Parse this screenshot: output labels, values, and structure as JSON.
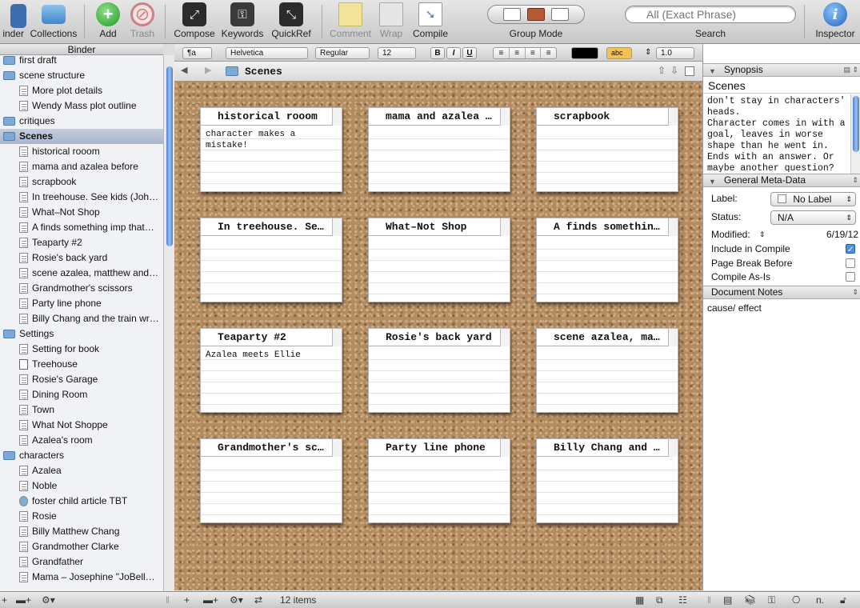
{
  "toolbar": {
    "binder": "Binder",
    "binder_visible": "inder",
    "collections": "Collections",
    "add": "Add",
    "trash": "Trash",
    "compose": "Compose",
    "keywords": "Keywords",
    "quickref": "QuickRef",
    "comment": "Comment",
    "wrap": "Wrap",
    "compile": "Compile",
    "group_mode": "Group Mode",
    "search_placeholder": "All (Exact Phrase)",
    "search_label": "Search",
    "inspector": "Inspector"
  },
  "binder": {
    "header": "Binder",
    "items": [
      {
        "label": "first draft",
        "icon": "folder-icon",
        "indent": 0
      },
      {
        "label": "scene structure",
        "icon": "folder-icon",
        "indent": 0
      },
      {
        "label": "More plot details",
        "icon": "document-icon",
        "indent": 1
      },
      {
        "label": "Wendy Mass plot outline",
        "icon": "document-icon",
        "indent": 1
      },
      {
        "label": "critiques",
        "icon": "folder-icon",
        "indent": 0
      },
      {
        "label": "Scenes",
        "icon": "folder-icon",
        "indent": 0,
        "selected": true
      },
      {
        "label": "historical rooom",
        "icon": "document-icon",
        "indent": 1
      },
      {
        "label": "mama and azalea before",
        "icon": "document-icon",
        "indent": 1
      },
      {
        "label": "scrapbook",
        "icon": "document-icon",
        "indent": 1
      },
      {
        "label": "In treehouse. See kids (Joh…",
        "icon": "document-icon",
        "indent": 1
      },
      {
        "label": "What–Not Shop",
        "icon": "document-icon",
        "indent": 1
      },
      {
        "label": "A finds something imp that…",
        "icon": "document-icon",
        "indent": 1
      },
      {
        "label": "Teaparty #2",
        "icon": "document-icon",
        "indent": 1
      },
      {
        "label": "Rosie's back yard",
        "icon": "document-icon",
        "indent": 1
      },
      {
        "label": "scene azalea, matthew and …",
        "icon": "document-icon",
        "indent": 1
      },
      {
        "label": "Grandmother's scissors",
        "icon": "document-icon",
        "indent": 1
      },
      {
        "label": "Party line phone",
        "icon": "document-icon",
        "indent": 1
      },
      {
        "label": "Billy Chang and the train wr…",
        "icon": "document-icon",
        "indent": 1
      },
      {
        "label": "Settings",
        "icon": "folder-icon",
        "indent": 0
      },
      {
        "label": "Setting for book",
        "icon": "document-icon",
        "indent": 1
      },
      {
        "label": "Treehouse",
        "icon": "blank-document-icon",
        "indent": 1
      },
      {
        "label": "Rosie's Garage",
        "icon": "document-icon",
        "indent": 1
      },
      {
        "label": "Dining Room",
        "icon": "document-icon",
        "indent": 1
      },
      {
        "label": "Town",
        "icon": "document-icon",
        "indent": 1
      },
      {
        "label": "What Not Shoppe",
        "icon": "document-icon",
        "indent": 1
      },
      {
        "label": "Azalea's room",
        "icon": "document-icon",
        "indent": 1
      },
      {
        "label": "characters",
        "icon": "folder-icon",
        "indent": 0
      },
      {
        "label": "Azalea",
        "icon": "document-icon",
        "indent": 1
      },
      {
        "label": "Noble",
        "icon": "document-icon",
        "indent": 1
      },
      {
        "label": "foster child article TBT",
        "icon": "web-document-icon",
        "indent": 1
      },
      {
        "label": "Rosie",
        "icon": "document-icon",
        "indent": 1
      },
      {
        "label": "Billy Matthew Chang",
        "icon": "document-icon",
        "indent": 1
      },
      {
        "label": "Grandmother Clarke",
        "icon": "document-icon",
        "indent": 1
      },
      {
        "label": "Grandfather",
        "icon": "document-icon",
        "indent": 1
      },
      {
        "label": "Mama – Josephine \"JoBelle\" …",
        "icon": "document-icon",
        "indent": 1
      }
    ]
  },
  "format_bar": {
    "style": "¶a",
    "font": "Helvetica",
    "weight": "Regular",
    "size": "12",
    "bold": "B",
    "italic": "I",
    "underline": "U",
    "highlight": "abc",
    "line_spacing": "1.0"
  },
  "path_bar": {
    "title": "Scenes"
  },
  "cards": [
    {
      "title": "historical rooom",
      "synopsis": "character makes a mistake!"
    },
    {
      "title": "mama and azalea …",
      "synopsis": ""
    },
    {
      "title": "scrapbook",
      "synopsis": ""
    },
    {
      "title": "In treehouse. Se…",
      "synopsis": ""
    },
    {
      "title": "What–Not Shop",
      "synopsis": ""
    },
    {
      "title": "A finds somethin…",
      "synopsis": ""
    },
    {
      "title": "Teaparty #2",
      "synopsis": "Azalea meets Ellie"
    },
    {
      "title": "Rosie's back yard",
      "synopsis": ""
    },
    {
      "title": "scene azalea, ma…",
      "synopsis": ""
    },
    {
      "title": "Grandmother's sc…",
      "synopsis": ""
    },
    {
      "title": "Party line phone",
      "synopsis": ""
    },
    {
      "title": "Billy Chang and …",
      "synopsis": ""
    }
  ],
  "inspector": {
    "synopsis_header": "Synopsis",
    "title": "Scenes",
    "synopsis": "don't stay in characters' heads.\nCharacter comes in with a goal, leaves in worse shape than he went in.\nEnds with an answer. Or maybe another question?",
    "meta_header": "General Meta-Data",
    "label_key": "Label:",
    "label_value": "No Label",
    "status_key": "Status:",
    "status_value": "N/A",
    "modified_key": "Modified:",
    "modified_value": "6/19/12",
    "include_in_compile": "Include in Compile",
    "include_checked": true,
    "page_break_before": "Page Break Before",
    "page_break_checked": false,
    "compile_as_is": "Compile As-Is",
    "compile_as_is_checked": false,
    "notes_header": "Document Notes",
    "notes": "cause/ effect"
  },
  "status": {
    "item_count": "12 items"
  },
  "colors": {
    "accent": "#4a7fd0",
    "cork": "#b48c62",
    "selection": "#b0bccf"
  }
}
